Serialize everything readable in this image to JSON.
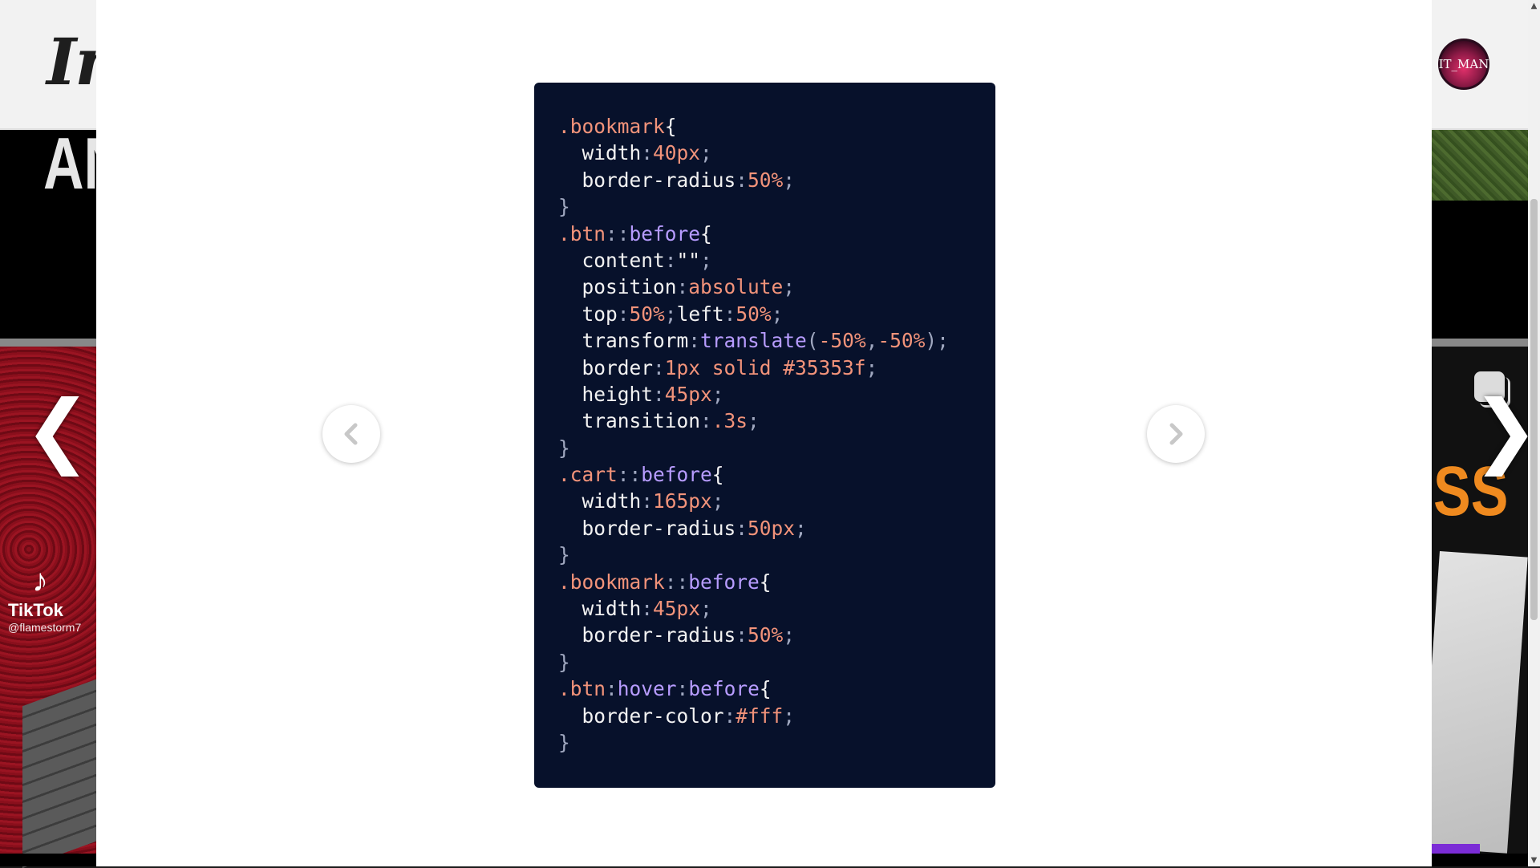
{
  "background": {
    "logo_text": "In",
    "avatar_text": "IT_MAN",
    "banner_text_left": "AN",
    "banner_text_right": "SS",
    "tiktok_name": "TikTok",
    "tiktok_handle": "@flamestorm7",
    "tiktok_icon": "music-note-icon",
    "arrow_left": "❮",
    "arrow_right": "❯"
  },
  "lightbox": {
    "prev_icon": "chevron-left-icon",
    "next_icon": "chevron-right-icon"
  },
  "colors": {
    "card_bg": "#07112b",
    "selector": "#f2937a",
    "pseudo": "#b79cff",
    "brace": "#f2f2f2",
    "property": "#f2f2f2",
    "value": "#f2937a",
    "punct": "#a0a8c0",
    "func": "#b79cff"
  },
  "code_lines": [
    [
      {
        "t": ".bookmark",
        "c": "selector"
      },
      {
        "t": "{",
        "c": "brace"
      }
    ],
    [
      {
        "t": "  width",
        "c": "property"
      },
      {
        "t": ":",
        "c": "punct"
      },
      {
        "t": "40px",
        "c": "value"
      },
      {
        "t": ";",
        "c": "punct"
      }
    ],
    [
      {
        "t": "  border-radius",
        "c": "property"
      },
      {
        "t": ":",
        "c": "punct"
      },
      {
        "t": "50%",
        "c": "value"
      },
      {
        "t": ";",
        "c": "punct"
      }
    ],
    [
      {
        "t": "}",
        "c": "punct"
      }
    ],
    [
      {
        "t": ".btn",
        "c": "selector"
      },
      {
        "t": "::",
        "c": "punct"
      },
      {
        "t": "before",
        "c": "pseudo"
      },
      {
        "t": "{",
        "c": "brace"
      }
    ],
    [
      {
        "t": "  content",
        "c": "property"
      },
      {
        "t": ":",
        "c": "punct"
      },
      {
        "t": "\"\"",
        "c": "property"
      },
      {
        "t": ";",
        "c": "punct"
      }
    ],
    [
      {
        "t": "  position",
        "c": "property"
      },
      {
        "t": ":",
        "c": "punct"
      },
      {
        "t": "absolute",
        "c": "value"
      },
      {
        "t": ";",
        "c": "punct"
      }
    ],
    [
      {
        "t": "  top",
        "c": "property"
      },
      {
        "t": ":",
        "c": "punct"
      },
      {
        "t": "50%",
        "c": "value"
      },
      {
        "t": ";",
        "c": "punct"
      },
      {
        "t": "left",
        "c": "property"
      },
      {
        "t": ":",
        "c": "punct"
      },
      {
        "t": "50%",
        "c": "value"
      },
      {
        "t": ";",
        "c": "punct"
      }
    ],
    [
      {
        "t": "  transform",
        "c": "property"
      },
      {
        "t": ":",
        "c": "punct"
      },
      {
        "t": "translate",
        "c": "func"
      },
      {
        "t": "(",
        "c": "punct"
      },
      {
        "t": "-50%",
        "c": "value"
      },
      {
        "t": ",",
        "c": "punct"
      },
      {
        "t": "-50%",
        "c": "value"
      },
      {
        "t": ");",
        "c": "punct"
      }
    ],
    [
      {
        "t": "  border",
        "c": "property"
      },
      {
        "t": ":",
        "c": "punct"
      },
      {
        "t": "1px solid #35353f",
        "c": "value"
      },
      {
        "t": ";",
        "c": "punct"
      }
    ],
    [
      {
        "t": "  height",
        "c": "property"
      },
      {
        "t": ":",
        "c": "punct"
      },
      {
        "t": "45px",
        "c": "value"
      },
      {
        "t": ";",
        "c": "punct"
      }
    ],
    [
      {
        "t": "  transition",
        "c": "property"
      },
      {
        "t": ":",
        "c": "punct"
      },
      {
        "t": ".3s",
        "c": "value"
      },
      {
        "t": ";",
        "c": "punct"
      }
    ],
    [
      {
        "t": "}",
        "c": "punct"
      }
    ],
    [
      {
        "t": ".cart",
        "c": "selector"
      },
      {
        "t": "::",
        "c": "punct"
      },
      {
        "t": "before",
        "c": "pseudo"
      },
      {
        "t": "{",
        "c": "brace"
      }
    ],
    [
      {
        "t": "  width",
        "c": "property"
      },
      {
        "t": ":",
        "c": "punct"
      },
      {
        "t": "165px",
        "c": "value"
      },
      {
        "t": ";",
        "c": "punct"
      }
    ],
    [
      {
        "t": "  border-radius",
        "c": "property"
      },
      {
        "t": ":",
        "c": "punct"
      },
      {
        "t": "50px",
        "c": "value"
      },
      {
        "t": ";",
        "c": "punct"
      }
    ],
    [
      {
        "t": "}",
        "c": "punct"
      }
    ],
    [
      {
        "t": ".bookmark",
        "c": "selector"
      },
      {
        "t": "::",
        "c": "punct"
      },
      {
        "t": "before",
        "c": "pseudo"
      },
      {
        "t": "{",
        "c": "brace"
      }
    ],
    [
      {
        "t": "  width",
        "c": "property"
      },
      {
        "t": ":",
        "c": "punct"
      },
      {
        "t": "45px",
        "c": "value"
      },
      {
        "t": ";",
        "c": "punct"
      }
    ],
    [
      {
        "t": "  border-radius",
        "c": "property"
      },
      {
        "t": ":",
        "c": "punct"
      },
      {
        "t": "50%",
        "c": "value"
      },
      {
        "t": ";",
        "c": "punct"
      }
    ],
    [
      {
        "t": "}",
        "c": "punct"
      }
    ],
    [
      {
        "t": ".btn",
        "c": "selector"
      },
      {
        "t": ":",
        "c": "punct"
      },
      {
        "t": "hover",
        "c": "pseudo"
      },
      {
        "t": ":",
        "c": "punct"
      },
      {
        "t": "before",
        "c": "pseudo"
      },
      {
        "t": "{",
        "c": "brace"
      }
    ],
    [
      {
        "t": "  border-color",
        "c": "property"
      },
      {
        "t": ":",
        "c": "punct"
      },
      {
        "t": "#fff",
        "c": "value"
      },
      {
        "t": ";",
        "c": "punct"
      }
    ],
    [
      {
        "t": "}",
        "c": "punct"
      }
    ]
  ]
}
